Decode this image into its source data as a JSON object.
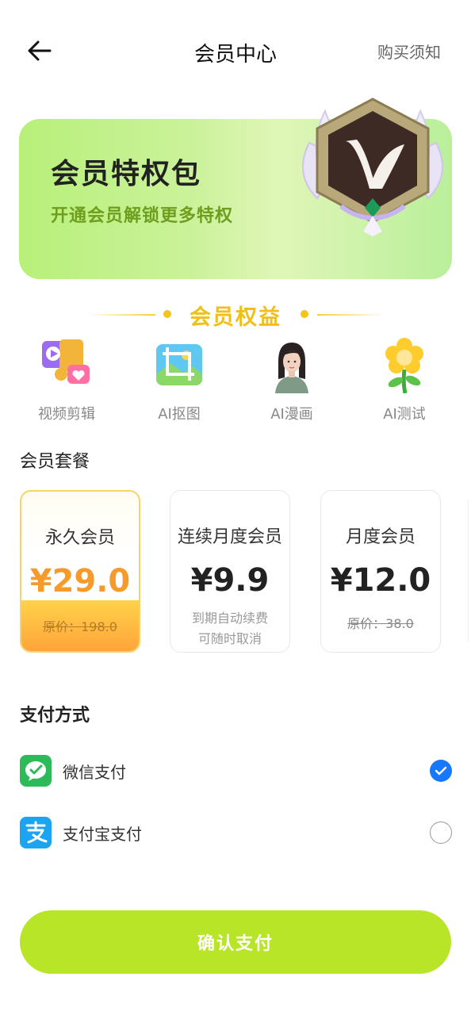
{
  "header": {
    "title": "会员中心",
    "notice_link": "购买须知"
  },
  "banner": {
    "title": "会员特权包",
    "subtitle": "开通会员解锁更多特权"
  },
  "benefits": {
    "title": "会员权益",
    "items": [
      {
        "label": "视频剪辑",
        "icon": "video-edit-icon"
      },
      {
        "label": "AI抠图",
        "icon": "image-cutout-icon"
      },
      {
        "label": "AI漫画",
        "icon": "ai-comic-portrait-icon"
      },
      {
        "label": "AI测试",
        "icon": "flower-test-icon"
      }
    ]
  },
  "plans": {
    "label": "会员套餐",
    "items": [
      {
        "name": "永久会员",
        "price": "¥29.0",
        "original": "原价：198.0",
        "selected": true
      },
      {
        "name": "连续月度会员",
        "price": "¥9.9",
        "note_line1": "到期自动续费",
        "note_line2": "可随时取消",
        "selected": false
      },
      {
        "name": "月度会员",
        "price": "¥12.0",
        "original": "原价：38.0",
        "selected": false
      }
    ]
  },
  "payment": {
    "label": "支付方式",
    "methods": [
      {
        "name": "微信支付",
        "icon": "wechat-pay-icon",
        "checked": true
      },
      {
        "name": "支付宝支付",
        "icon": "alipay-icon",
        "checked": false
      }
    ]
  },
  "confirm_label": "确认支付",
  "colors": {
    "accent_green": "#b9e528",
    "gold": "#f2be18",
    "price_orange": "#f79a2c",
    "check_blue": "#1677ff"
  }
}
